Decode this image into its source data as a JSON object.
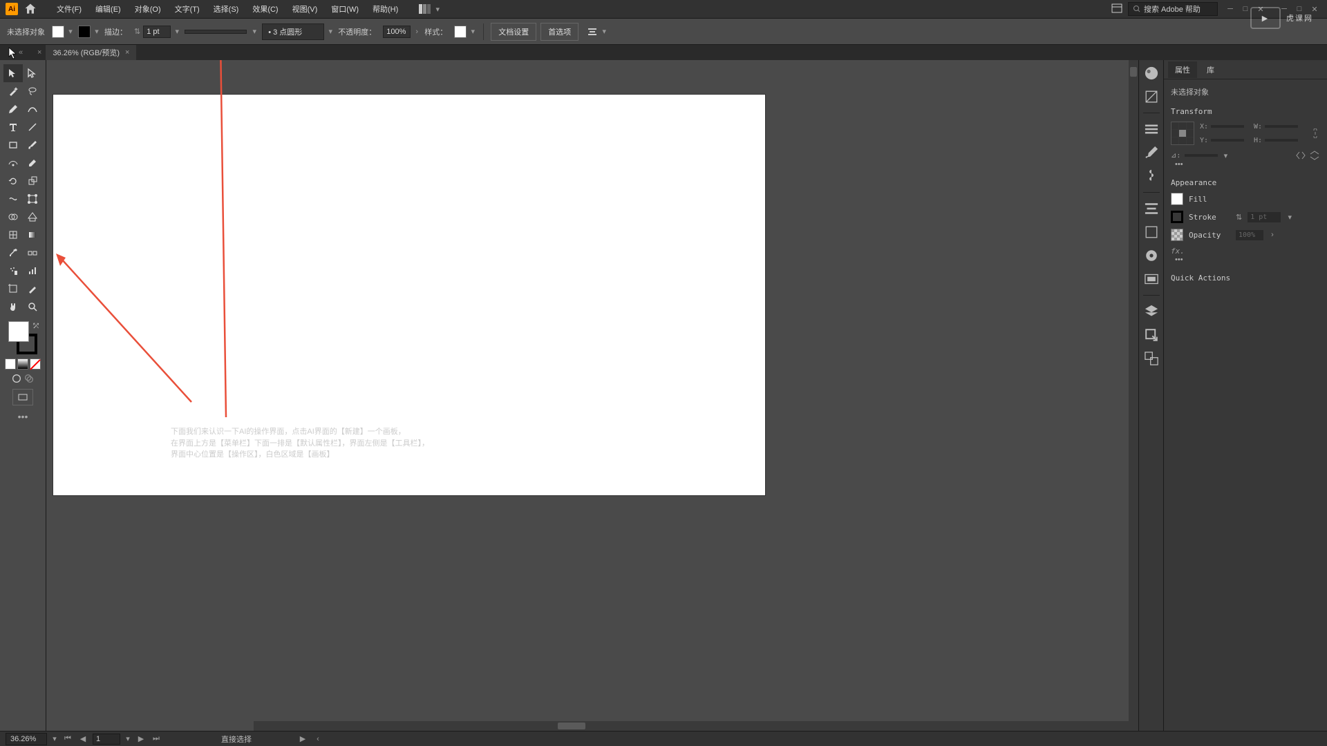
{
  "app": {
    "icon_text": "Ai"
  },
  "menubar": {
    "items": [
      "文件(F)",
      "编辑(E)",
      "对象(O)",
      "文字(T)",
      "选择(S)",
      "效果(C)",
      "视图(V)",
      "窗口(W)",
      "帮助(H)"
    ],
    "search_placeholder": "搜索 Adobe 帮助"
  },
  "controlbar": {
    "no_selection": "未选择对象",
    "stroke_label": "描边：",
    "stroke_value": "1 pt",
    "brush_preset": "• 3 点圆形",
    "opacity_label": "不透明度：",
    "opacity_value": "100%",
    "style_label": "样式：",
    "doc_setup": "文档设置",
    "prefs": "首选项"
  },
  "doc_tab": {
    "title": "36.26% (RGB/预览)"
  },
  "properties": {
    "tabs": [
      "属性",
      "库"
    ],
    "no_selection": "未选择对象",
    "transform_title": "Transform",
    "fields": {
      "x": "X:",
      "y": "Y:",
      "w": "W:",
      "h": "H:",
      "angle": "⊿:"
    },
    "appearance_title": "Appearance",
    "fill_label": "Fill",
    "stroke_label": "Stroke",
    "stroke_value": "1 pt",
    "opacity_label": "Opacity",
    "opacity_value": "100%",
    "fx_label": "fx.",
    "quick_actions": "Quick Actions"
  },
  "statusbar": {
    "zoom": "36.26%",
    "page": "1",
    "tool_status": "直接选择"
  },
  "annotation": {
    "line1": "下面我们来认识一下AI的操作界面，点击AI界面的【新建】一个画板，",
    "line2": "在界面上方是【菜单栏】下面一排是【默认属性栏】，界面左侧是【工具栏】，",
    "line3": "界面中心位置是【操作区】，白色区域是【画板】"
  },
  "watermark": {
    "text": "虎课网"
  }
}
